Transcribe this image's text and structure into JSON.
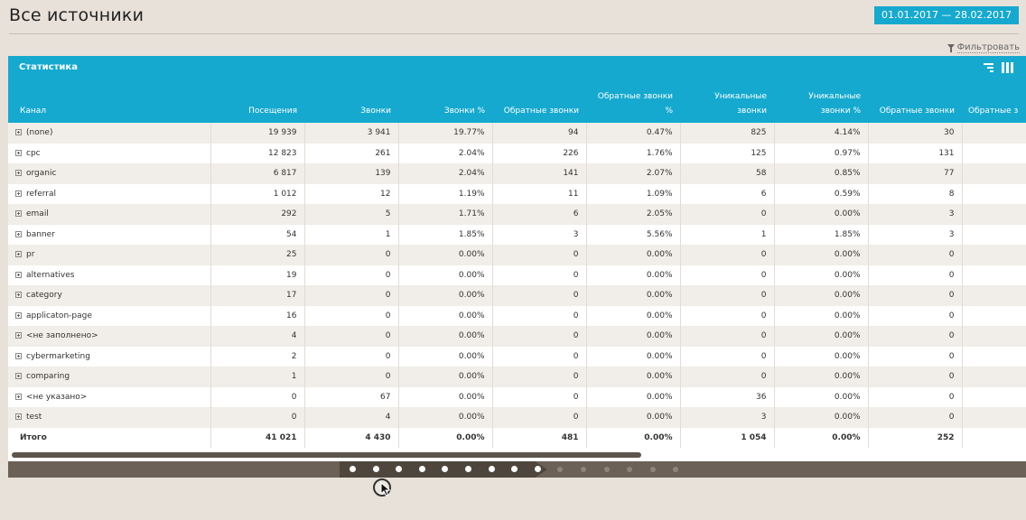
{
  "page": {
    "title": "Все источники"
  },
  "date_range": {
    "label": "01.01.2017  —  28.02.2017"
  },
  "filter": {
    "label": "Фильтровать"
  },
  "panel": {
    "title": "Статистика",
    "sort_icon": "sort-lines-icon",
    "columns_icon": "columns-icon"
  },
  "table": {
    "columns": [
      {
        "line1": "",
        "line2": "Канал"
      },
      {
        "line1": "",
        "line2": "Посещения",
        "sorted": true
      },
      {
        "line1": "",
        "line2": "Звонки"
      },
      {
        "line1": "",
        "line2": "Звонки %"
      },
      {
        "line1": "",
        "line2": "Обратные звонки"
      },
      {
        "line1": "Обратные звонки",
        "line2": "%"
      },
      {
        "line1": "Уникальные",
        "line2": "звонки"
      },
      {
        "line1": "Уникальные",
        "line2": "звонки %"
      },
      {
        "line1": "",
        "line2": "Обратные звонки"
      },
      {
        "line1": "Обратные з",
        "line2": ""
      }
    ],
    "rows": [
      [
        "(none)",
        "19 939",
        "3 941",
        "19.77%",
        "94",
        "0.47%",
        "825",
        "4.14%",
        "30"
      ],
      [
        "cpc",
        "12 823",
        "261",
        "2.04%",
        "226",
        "1.76%",
        "125",
        "0.97%",
        "131"
      ],
      [
        "organic",
        "6 817",
        "139",
        "2.04%",
        "141",
        "2.07%",
        "58",
        "0.85%",
        "77"
      ],
      [
        "referral",
        "1 012",
        "12",
        "1.19%",
        "11",
        "1.09%",
        "6",
        "0.59%",
        "8"
      ],
      [
        "email",
        "292",
        "5",
        "1.71%",
        "6",
        "2.05%",
        "0",
        "0.00%",
        "3"
      ],
      [
        "banner",
        "54",
        "1",
        "1.85%",
        "3",
        "5.56%",
        "1",
        "1.85%",
        "3"
      ],
      [
        "pr",
        "25",
        "0",
        "0.00%",
        "0",
        "0.00%",
        "0",
        "0.00%",
        "0"
      ],
      [
        "alternatives",
        "19",
        "0",
        "0.00%",
        "0",
        "0.00%",
        "0",
        "0.00%",
        "0"
      ],
      [
        "category",
        "17",
        "0",
        "0.00%",
        "0",
        "0.00%",
        "0",
        "0.00%",
        "0"
      ],
      [
        "applicaton-page",
        "16",
        "0",
        "0.00%",
        "0",
        "0.00%",
        "0",
        "0.00%",
        "0"
      ],
      [
        "<не заполнено>",
        "4",
        "0",
        "0.00%",
        "0",
        "0.00%",
        "0",
        "0.00%",
        "0"
      ],
      [
        "cybermarketing",
        "2",
        "0",
        "0.00%",
        "0",
        "0.00%",
        "0",
        "0.00%",
        "0"
      ],
      [
        "comparing",
        "1",
        "0",
        "0.00%",
        "0",
        "0.00%",
        "0",
        "0.00%",
        "0"
      ],
      [
        "<не указано>",
        "0",
        "67",
        "0.00%",
        "0",
        "0.00%",
        "36",
        "0.00%",
        "0"
      ],
      [
        "test",
        "0",
        "4",
        "0.00%",
        "0",
        "0.00%",
        "3",
        "0.00%",
        "0"
      ]
    ],
    "total": [
      "Итого",
      "41 021",
      "4 430",
      "0.00%",
      "481",
      "0.00%",
      "1 054",
      "0.00%",
      "252"
    ]
  },
  "pager": {
    "active_dots": 9,
    "inactive_dots": 6,
    "current": 2
  },
  "colors": {
    "accent": "#16a9cf",
    "pager_bar": "#6b6156",
    "background": "#e8e1d9"
  }
}
